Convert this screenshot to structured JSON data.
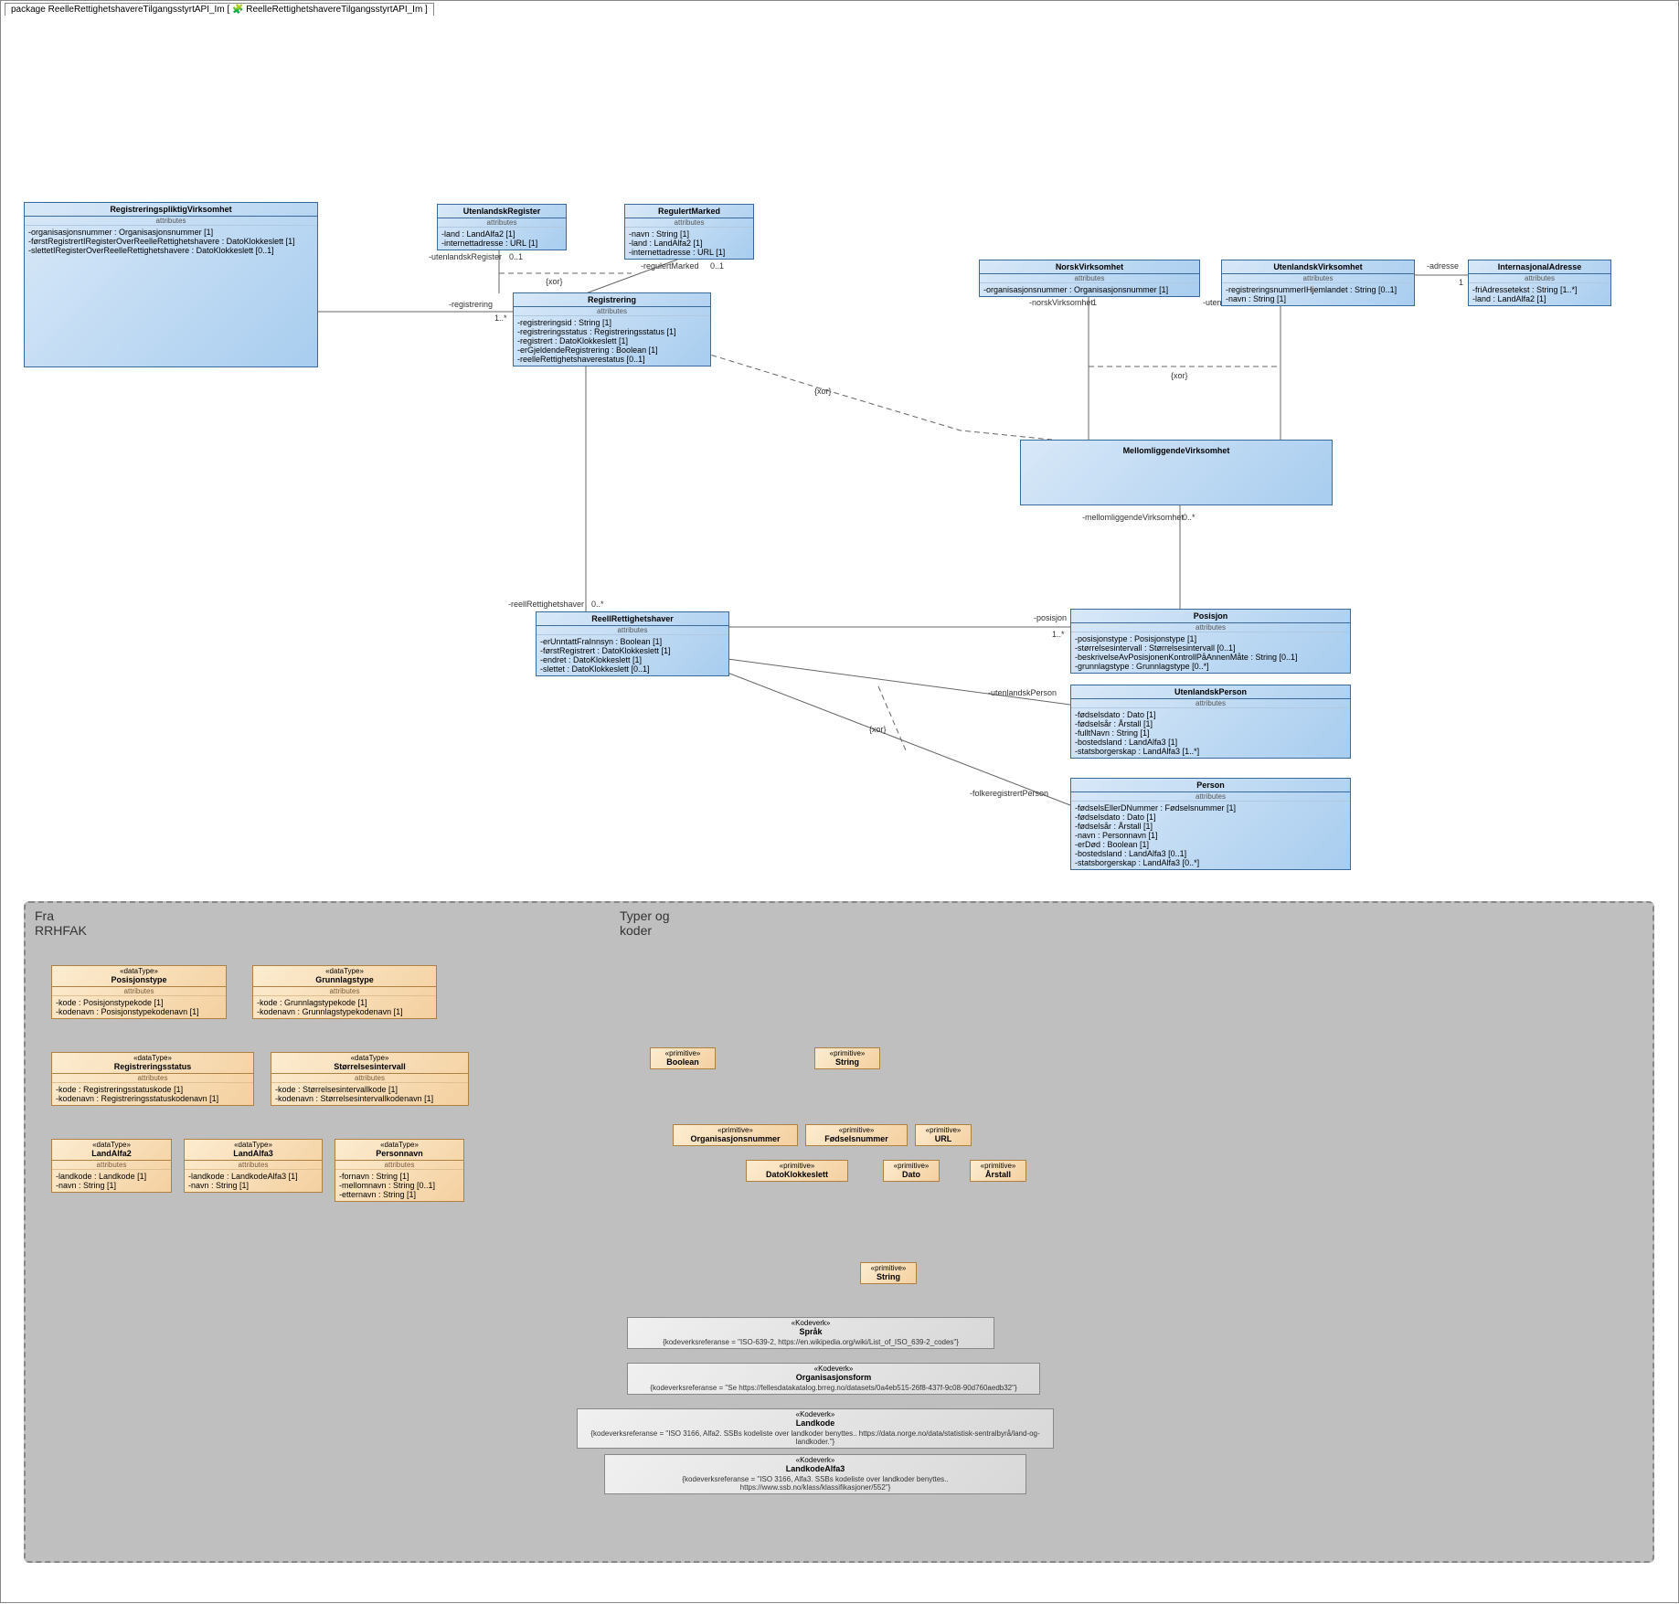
{
  "package_label_prefix": "package ",
  "package_name": "ReelleRettighetshavereTilgangsstyrtAPI_Im",
  "package_tab_tail": " [ 🧩 ReelleRettighetshavereTilgangsstyrtAPI_Im ]",
  "classes": {
    "registreringspliktig": {
      "title": "RegistreringspliktigVirksomhet",
      "attr_label": "attributes",
      "attrs": [
        "-organisasjonsnummer : Organisasjonsnummer [1]",
        "-førstRegistrertIRegisterOverReelleRettighetshavere : DatoKlokkeslett [1]",
        "-slettetIRegisterOverReelleRettighetshavere : DatoKlokkeslett [0..1]"
      ]
    },
    "utenlandskRegister": {
      "title": "UtenlandskRegister",
      "attr_label": "attributes",
      "attrs": [
        "-land : LandAlfa2 [1]",
        "-internettadresse : URL [1]"
      ]
    },
    "regulertMarked": {
      "title": "RegulertMarked",
      "attr_label": "attributes",
      "attrs": [
        "-navn : String [1]",
        "-land : LandAlfa2 [1]",
        "-internettadresse : URL [1]"
      ]
    },
    "registrering": {
      "title": "Registrering",
      "attr_label": "attributes",
      "attrs": [
        "-registreringsid : String [1]",
        "-registreringsstatus : Registreringsstatus [1]",
        "-registrert : DatoKlokkeslett [1]",
        "-erGjeldendeRegistrering : Boolean [1]",
        "-reelleRettighetshaverestatus [0..1]"
      ]
    },
    "reellRettighetshaver": {
      "title": "ReellRettighetshaver",
      "attr_label": "attributes",
      "attrs": [
        "-erUnntattFraInnsyn : Boolean [1]",
        "-førstRegistrert : DatoKlokkeslett [1]",
        "-endret : DatoKlokkeslett [1]",
        "-slettet : DatoKlokkeslett [0..1]"
      ]
    },
    "norskVirksomhet": {
      "title": "NorskVirksomhet",
      "attr_label": "attributes",
      "attrs": [
        "-organisasjonsnummer : Organisasjonsnummer [1]"
      ]
    },
    "utenlandskVirksomhet": {
      "title": "UtenlandskVirksomhet",
      "attr_label": "attributes",
      "attrs": [
        "-registreringsnummerIHjemlandet : String [0..1]",
        "-navn : String [1]"
      ]
    },
    "internasjonalAdresse": {
      "title": "InternasjonalAdresse",
      "attr_label": "attributes",
      "attrs": [
        "-friAdressetekst : String [1..*]",
        "-land : LandAlfa2 [1]"
      ]
    },
    "mellomliggende": {
      "title": "MellomliggendeVirksomhet"
    },
    "posisjon": {
      "title": "Posisjon",
      "attr_label": "attributes",
      "attrs": [
        "-posisjonstype : Posisjonstype [1]",
        "-størrelsesintervall : Størrelsesintervall [0..1]",
        "-beskrivelseAvPosisjonenKontrollPåAnnenMåte : String [0..1]",
        "-grunnlagstype : Grunnlagstype [0..*]"
      ]
    },
    "utenlandskPerson": {
      "title": "UtenlandskPerson",
      "attr_label": "attributes",
      "attrs": [
        "-fødselsdato : Dato [1]",
        "-fødselsår : Årstall [1]",
        "-fulltNavn : String [1]",
        "-bostedsland : LandAlfa3 [1]",
        "-statsborgerskap : LandAlfa3 [1..*]"
      ]
    },
    "person": {
      "title": "Person",
      "attr_label": "attributes",
      "attrs": [
        "-fødselsEllerDNummer : Fødselsnummer [1]",
        "-fødselsdato : Dato [1]",
        "-fødselsår : Årstall [1]",
        "-navn : Personnavn [1]",
        "-erDød : Boolean [1]",
        "-bostedsland : LandAlfa3 [0..1]",
        "-statsborgerskap : LandAlfa3 [0..*]"
      ]
    }
  },
  "regions": {
    "fra": {
      "title_line1": "Fra",
      "title_line2": "RRHFAK"
    },
    "typer": {
      "title_line1": "Typer og",
      "title_line2": "koder"
    }
  },
  "datatypes": {
    "posisjonstype": {
      "stereo": "«dataType»",
      "title": "Posisjonstype",
      "attr_label": "attributes",
      "attrs": [
        "-kode : Posisjonstypekode [1]",
        "-kodenavn : Posisjonstypekodenavn [1]"
      ]
    },
    "grunnlagstype": {
      "stereo": "«dataType»",
      "title": "Grunnlagstype",
      "attr_label": "attributes",
      "attrs": [
        "-kode : Grunnlagstypekode [1]",
        "-kodenavn : Grunnlagstypekodenavn [1]"
      ]
    },
    "registreringsstatus": {
      "stereo": "«dataType»",
      "title": "Registreringsstatus",
      "attr_label": "attributes",
      "attrs": [
        "-kode : Registreringsstatuskode [1]",
        "-kodenavn : Registreringsstatuskodenavn [1]"
      ]
    },
    "storrelsesintervall": {
      "stereo": "«dataType»",
      "title": "Størrelsesintervall",
      "attr_label": "attributes",
      "attrs": [
        "-kode : Størrelsesintervallkode [1]",
        "-kodenavn : Størrelsesintervallkodenavn [1]"
      ]
    },
    "landalfa2": {
      "stereo": "«dataType»",
      "title": "LandAlfa2",
      "attr_label": "attributes",
      "attrs": [
        "-landkode : Landkode [1]",
        "-navn : String [1]"
      ]
    },
    "landalfa3": {
      "stereo": "«dataType»",
      "title": "LandAlfa3",
      "attr_label": "attributes",
      "attrs": [
        "-landkode : LandkodeAlfa3 [1]",
        "-navn : String [1]"
      ]
    },
    "personnavn": {
      "stereo": "«dataType»",
      "title": "Personnavn",
      "attr_label": "attributes",
      "attrs": [
        "-fornavn : String [1]",
        "-mellomnavn : String [0..1]",
        "-etternavn : String [1]"
      ]
    }
  },
  "primitives": {
    "boolean": {
      "stereo": "«primitive»",
      "title": "Boolean"
    },
    "string": {
      "stereo": "«primitive»",
      "title": "String"
    },
    "orgnr": {
      "stereo": "«primitive»",
      "title": "Organisasjonsnummer"
    },
    "fodselsnr": {
      "stereo": "«primitive»",
      "title": "Fødselsnummer"
    },
    "url": {
      "stereo": "«primitive»",
      "title": "URL"
    },
    "datoklokkeslett": {
      "stereo": "«primitive»",
      "title": "DatoKlokkeslett"
    },
    "dato": {
      "stereo": "«primitive»",
      "title": "Dato"
    },
    "arstall": {
      "stereo": "«primitive»",
      "title": "Årstall"
    },
    "string2": {
      "stereo": "«primitive»",
      "title": "String"
    }
  },
  "kodeverk": {
    "sprak": {
      "stereo": "«Kodeverk»",
      "title": "Språk",
      "note": "{kodeverksreferanse = \"ISO-639-2, https://en.wikipedia.org/wiki/List_of_ISO_639-2_codes\"}"
    },
    "orgform": {
      "stereo": "«Kodeverk»",
      "title": "Organisasjonsform",
      "note": "{kodeverksreferanse = \"Se https://fellesdatakatalog.brreg.no/datasets/0a4eb515-26f8-437f-9c08-90d760aedb32\"}"
    },
    "landkode": {
      "stereo": "«Kodeverk»",
      "title": "Landkode",
      "note": "{kodeverksreferanse = \"ISO 3166, Alfa2. SSBs kodeliste over landkoder benyttes.. https://data.norge.no/data/statistisk-sentralbyrå/land-og-landkoder.\"}"
    },
    "landkodealfa3": {
      "stereo": "«Kodeverk»",
      "title": "LandkodeAlfa3",
      "note": "{kodeverksreferanse = \"ISO 3166, Alfa3. SSBs kodeliste over landkoder benyttes.. https://www.ssb.no/klass/klassifikasjoner/552\"}"
    }
  },
  "assoc_labels": {
    "registrering": "-registrering",
    "registrering_mult": "1..*",
    "utenlandskRegister": "-utenlandskRegister",
    "utenlandskRegister_mult": "0..1",
    "regulertMarked": "-regulertMarked",
    "regulertMarked_mult": "0..1",
    "xor1": "{xor}",
    "reellRettighetshaver": "-reellRettighetshaver",
    "reellRettighetshaver_mult": "0..*",
    "norskVirksomhet": "-norskVirksomhet",
    "norskVirksomhet_mult": "1",
    "utenlandskVirksomhet": "-utenlandskVirksomhet",
    "utenlandskVirksomhet_mult": "1",
    "adresse": "-adresse",
    "adresse_mult": "1",
    "xor2": "{xor}",
    "mellomliggende": "-mellomliggendeVirksomhet",
    "mellomliggende_mult": "0..*",
    "posisjon": "-posisjon",
    "posisjon_mult": "1..*",
    "utenlandskPerson": "-utenlandskPerson",
    "folkeregistrertPerson": "-folkeregistrertPerson",
    "xor3": "{xor}"
  }
}
